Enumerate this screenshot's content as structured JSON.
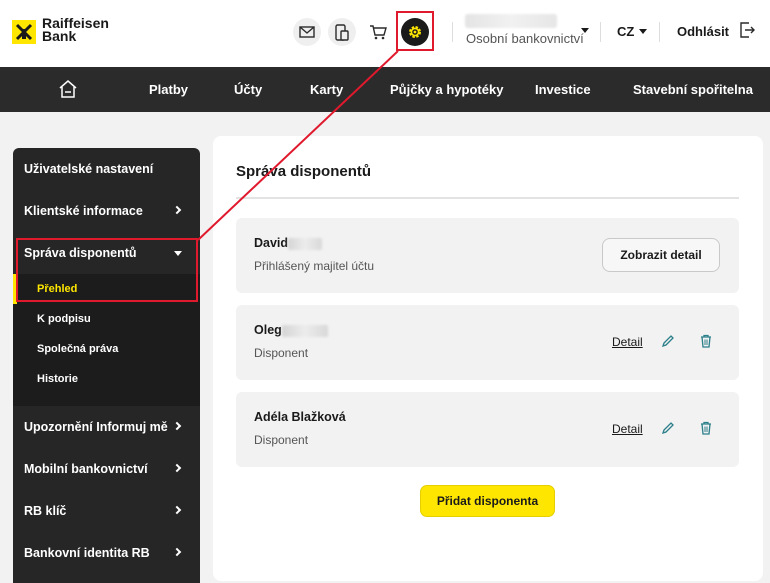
{
  "brand": {
    "line1": "Raiffeisen",
    "line2": "Bank",
    "color": "#fee600"
  },
  "header": {
    "icons": [
      "mail-icon",
      "mobile-document-icon",
      "cart-icon",
      "settings-gear-icon"
    ],
    "account_label": "Osobní bankovnictví",
    "language": "CZ",
    "logout_label": "Odhlásit"
  },
  "nav": {
    "items": [
      {
        "label": "Platby"
      },
      {
        "label": "Účty"
      },
      {
        "label": "Karty"
      },
      {
        "label": "Půjčky a hypotéky"
      },
      {
        "label": "Investice"
      },
      {
        "label": "Stavební spořitelna"
      }
    ]
  },
  "sidebar": {
    "items": [
      {
        "label": "Uživatelské nastavení"
      },
      {
        "label": "Klientské informace"
      },
      {
        "label": "Správa disponentů"
      },
      {
        "label": "Upozornění Informuj mě"
      },
      {
        "label": "Mobilní bankovnictví"
      },
      {
        "label": "RB klíč"
      },
      {
        "label": "Bankovní identita RB"
      }
    ],
    "submenu": [
      {
        "label": "Přehled"
      },
      {
        "label": "K podpisu"
      },
      {
        "label": "Společná práva"
      },
      {
        "label": "Historie"
      }
    ]
  },
  "main": {
    "title": "Správa disponentů",
    "owner": {
      "name": "David",
      "role": "Přihlášený majitel účtu",
      "button": "Zobrazit detail"
    },
    "disponents": [
      {
        "name": "Oleg",
        "role": "Disponent",
        "link": "Detail"
      },
      {
        "name": "Adéla Blažková",
        "role": "Disponent",
        "link": "Detail"
      }
    ],
    "add_button": "Přidat disponenta"
  },
  "colors": {
    "accent": "#fee600",
    "highlight": "#e0192d",
    "nav": "#2b2b2b",
    "sidebar": "#262626",
    "icon_teal": "#2a7f8a"
  }
}
